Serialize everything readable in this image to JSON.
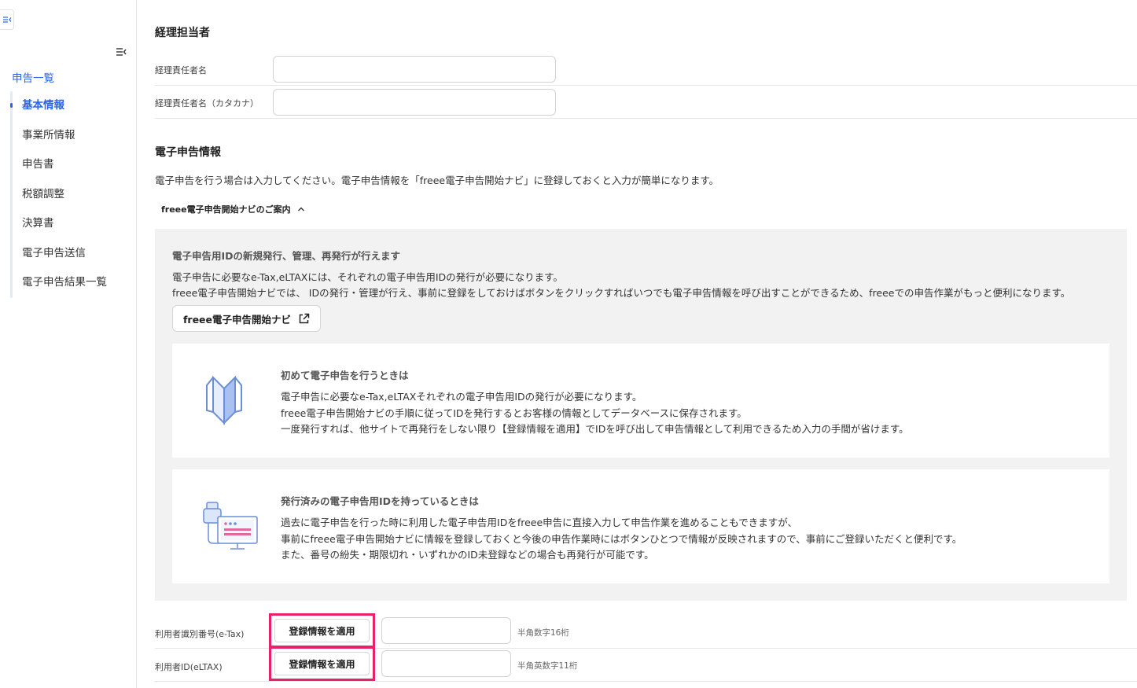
{
  "sidebar": {
    "top_link": "申告一覧",
    "items": [
      {
        "label": "基本情報",
        "active": true
      },
      {
        "label": "事業所情報"
      },
      {
        "label": "申告書"
      },
      {
        "label": "税額調整"
      },
      {
        "label": "決算書"
      },
      {
        "label": "電子申告送信"
      },
      {
        "label": "電子申告結果一覧"
      }
    ]
  },
  "accounting": {
    "title": "経理担当者",
    "name_label": "経理責任者名",
    "name_value": "",
    "kana_label": "経理責任者名（カタカナ）",
    "kana_value": ""
  },
  "efiling": {
    "title": "電子申告情報",
    "description": "電子申告を行う場合は入力してください。電子申告情報を「freee電子申告開始ナビ」に登録しておくと入力が簡単になります。",
    "guide_toggle": "freee電子申告開始ナビのご案内",
    "panel": {
      "heading": "電子申告用IDの新規発行、管理、再発行が行えます",
      "line1": "電子申告に必要なe-Tax,eLTAXには、それぞれの電子申告用IDの発行が必要になります。",
      "line2": "freee電子申告開始ナビでは、 IDの発行・管理が行え、事前に登録をしておけばボタンをクリックすればいつでも電子申告情報を呼び出すことができるため、freeeでの申告作業がもっと便利になります。",
      "navi_button": "freee電子申告開始ナビ"
    },
    "card_first": {
      "title": "初めて電子申告を行うときは",
      "lines": [
        "電子申告に必要なe-Tax,eLTAXそれぞれの電子申告用IDの発行が必要になります。",
        "freee電子申告開始ナビの手順に従ってIDを発行するとお客様の情報としてデータベースに保存されます。",
        "一度発行すれば、他サイトで再発行をしない限り【登録情報を適用】でIDを呼び出して申告情報として利用できるため入力の手間が省けます。"
      ]
    },
    "card_issued": {
      "title": "発行済みの電子申告用IDを持っているときは",
      "lines": [
        "過去に電子申告を行った時に利用した電子申告用IDをfreee申告に直接入力して申告作業を進めることもできますが、",
        "事前にfreee電子申告開始ナビに情報を登録しておくと今後の申告作業時にはボタンひとつで情報が反映されますので、事前にご登録いただくと便利です。",
        "また、番号の紛失・期限切れ・いずれかのID未登録などの場合も再発行が可能です。"
      ]
    },
    "etax": {
      "label": "利用者識別番号(e-Tax)",
      "button": "登録情報を適用",
      "value": "",
      "hint": "半角数字16桁"
    },
    "eltax": {
      "label": "利用者ID(eLTAX)",
      "button": "登録情報を適用",
      "value": "",
      "hint": "半角英数字11桁"
    }
  },
  "colors": {
    "accent": "#2864f0",
    "highlight": "#e8216b",
    "panel_bg": "#f2f2f2"
  }
}
